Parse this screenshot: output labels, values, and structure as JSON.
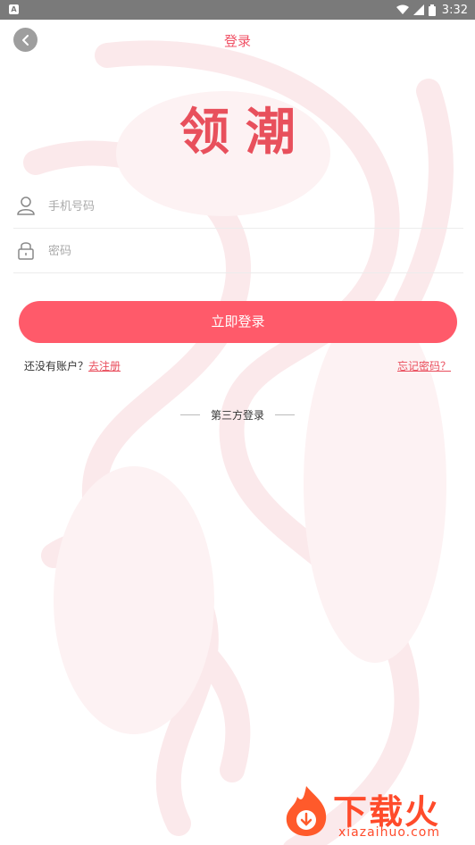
{
  "status_bar": {
    "app_icon_letter": "A",
    "time": "3:32"
  },
  "header": {
    "title": "登录"
  },
  "logo": {
    "text": "领潮"
  },
  "form": {
    "phone": {
      "placeholder": "手机号码",
      "value": ""
    },
    "password": {
      "placeholder": "密码",
      "value": ""
    }
  },
  "buttons": {
    "login_label": "立即登录"
  },
  "links": {
    "no_account_text": "还没有账户？",
    "register_label": "去注册",
    "forgot_label": "忘记密码？"
  },
  "third_party": {
    "label": "第三方登录"
  },
  "watermark": {
    "brand": "下载火",
    "site": "xiazaihuo.com"
  },
  "colors": {
    "accent": "#ff5a6a",
    "title": "#f05266",
    "watermark": "#ff4b2b"
  }
}
